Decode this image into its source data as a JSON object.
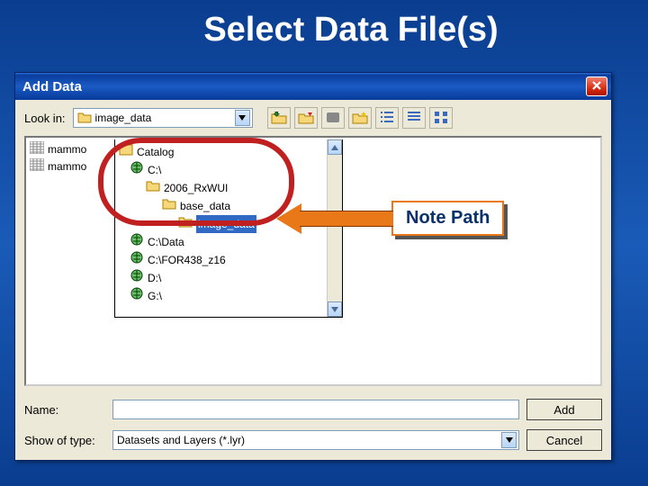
{
  "slide": {
    "title": "Select Data File(s)"
  },
  "dialog": {
    "title": "Add Data",
    "lookin_label": "Look in:",
    "lookin_value": "image_data",
    "name_label": "Name:",
    "name_value": "",
    "type_label": "Show of type:",
    "type_value": "Datasets and Layers (*.lyr)",
    "add_btn": "Add",
    "cancel_btn": "Cancel"
  },
  "file_list": [
    {
      "label": "mammo"
    },
    {
      "label": "mammo"
    }
  ],
  "tree": [
    {
      "depth": 0,
      "kind": "catalog",
      "label": "Catalog"
    },
    {
      "depth": 1,
      "kind": "drive",
      "label": "C:\\"
    },
    {
      "depth": 2,
      "kind": "folder",
      "label": "2006_RxWUI"
    },
    {
      "depth": 3,
      "kind": "folder",
      "label": "base_data"
    },
    {
      "depth": 4,
      "kind": "folder",
      "label": "image_data",
      "selected": true
    },
    {
      "depth": 1,
      "kind": "drive",
      "label": "C:\\Data"
    },
    {
      "depth": 1,
      "kind": "drive",
      "label": "C:\\FOR438_z16"
    },
    {
      "depth": 1,
      "kind": "drive",
      "label": "D:\\"
    },
    {
      "depth": 1,
      "kind": "drive",
      "label": "G:\\"
    }
  ],
  "callout": {
    "text": "Note Path"
  }
}
